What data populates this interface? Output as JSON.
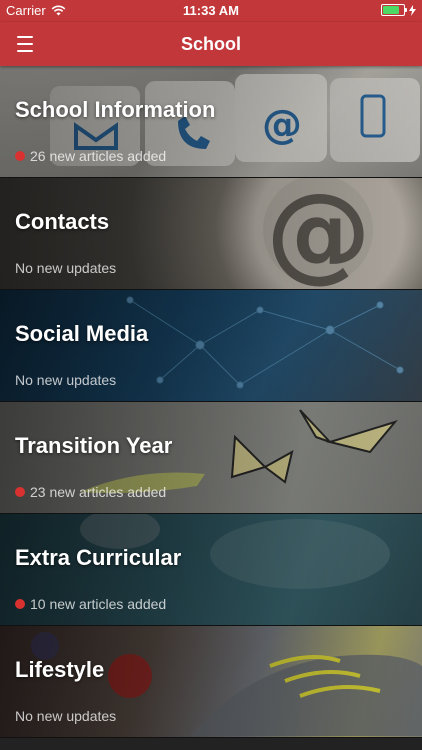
{
  "status_bar": {
    "carrier": "Carrier",
    "time": "11:33 AM"
  },
  "navbar": {
    "title": "School"
  },
  "items": [
    {
      "title": "School Information",
      "subtitle": "26 new articles added"
    },
    {
      "title": "Contacts",
      "subtitle": "No new updates"
    },
    {
      "title": "Social Media",
      "subtitle": "No new updates"
    },
    {
      "title": "Transition Year",
      "subtitle": "23 new articles added"
    },
    {
      "title": "Extra Curricular",
      "subtitle": "10 new articles added"
    },
    {
      "title": "Lifestyle",
      "subtitle": "No new updates"
    }
  ],
  "colors": {
    "accent": "#c2373a",
    "badge": "#d9312f"
  }
}
